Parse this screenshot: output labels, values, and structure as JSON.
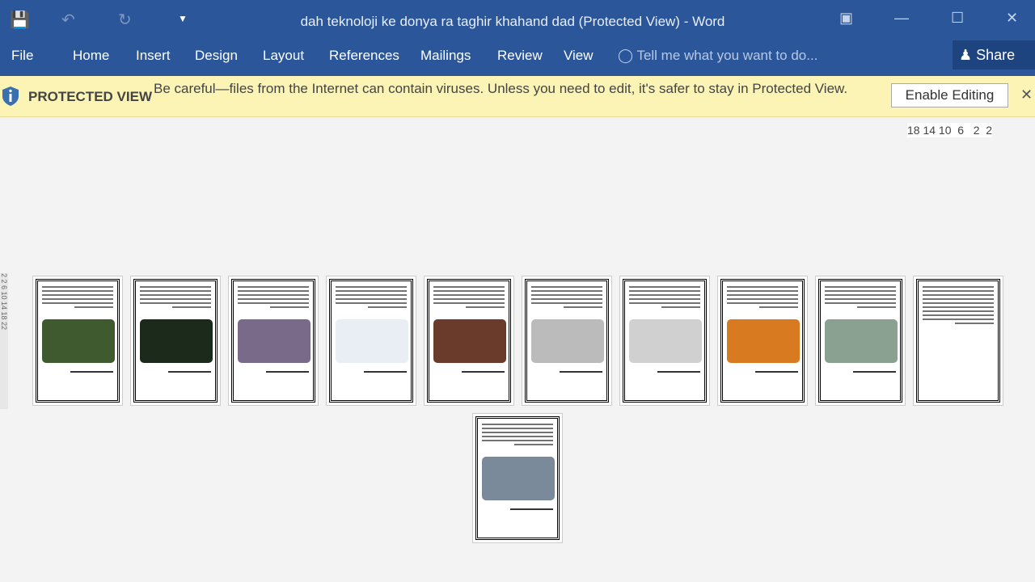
{
  "window": {
    "title": "dah teknoloji ke donya ra taghir khahand dad (Protected View) - Word"
  },
  "quick_access": [
    "save-icon",
    "undo-icon",
    "redo-icon",
    "customize-icon"
  ],
  "ribbon": {
    "tabs": [
      "File",
      "Home",
      "Insert",
      "Design",
      "Layout",
      "References",
      "Mailings",
      "Review",
      "View"
    ],
    "tell_me": "Tell me what you want to do...",
    "share": "Share"
  },
  "protected_view": {
    "label": "PROTECTED VIEW",
    "message": "Be careful—files from the Internet can contain viruses. Unless you need to edit, it's safer to stay in Protected View.",
    "button": "Enable Editing"
  },
  "ruler": {
    "label": "18 14 10  6   2  2"
  },
  "vruler": {
    "label": "2 2 6 10 14 18 22"
  },
  "pages": [
    {
      "image": "#3f5a2e"
    },
    {
      "image": "#1c2a1c"
    },
    {
      "image": "#7a6a8a"
    },
    {
      "image": "#e8eef4"
    },
    {
      "image": "#6a3a2a"
    },
    {
      "image": "#bbbbbb"
    },
    {
      "image": "#d0d0d0"
    },
    {
      "image": "#d87a20"
    },
    {
      "image": "#8aa090"
    },
    {
      "image": ""
    },
    {
      "image": "#7a8a9a"
    }
  ],
  "colors": {
    "ribbon": "#2b579a",
    "protected_bar": "#fcf4b4"
  }
}
